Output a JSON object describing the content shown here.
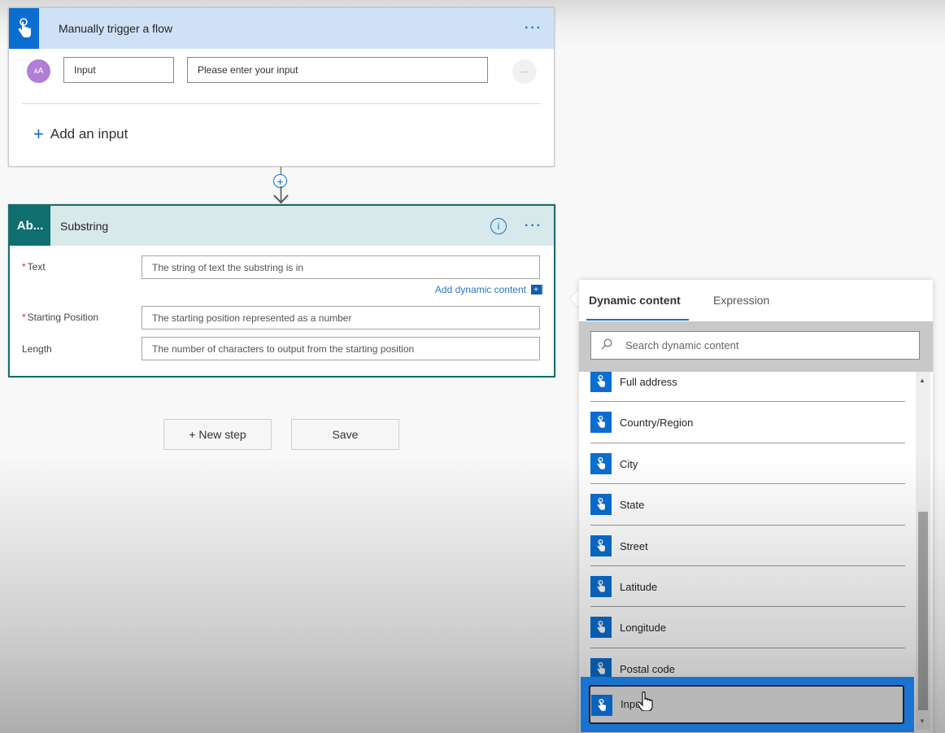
{
  "trigger": {
    "title": "Manually trigger a flow",
    "icon": "touch-hand-icon",
    "more_label": "···",
    "input_row": {
      "avatar_text": "ᴀA",
      "name_value": "Input",
      "prompt_value": "Please enter your input",
      "more_label": "···"
    },
    "add_input_label": "Add an input",
    "add_input_icon": "+"
  },
  "connector": {
    "plus": "+"
  },
  "action": {
    "icon_text": "Ab...",
    "title": "Substring",
    "info_label": "i",
    "more_label": "···",
    "fields": [
      {
        "label": "Text",
        "required": true,
        "placeholder": "The string of text the substring is in"
      },
      {
        "label": "Starting Position",
        "required": true,
        "placeholder": "The starting position represented as a number"
      },
      {
        "label": "Length",
        "required": false,
        "placeholder": "The number of characters to output from the starting position"
      }
    ],
    "required_mark": "*",
    "add_dynamic_label": "Add dynamic content",
    "add_dynamic_icon": "+"
  },
  "buttons": {
    "new_step": "+ New step",
    "save": "Save"
  },
  "dynamic_panel": {
    "tabs": [
      {
        "label": "Dynamic content",
        "active": true
      },
      {
        "label": "Expression",
        "active": false
      }
    ],
    "search_placeholder": "Search dynamic content",
    "items": [
      "Full address",
      "Country/Region",
      "City",
      "State",
      "Street",
      "Latitude",
      "Longitude",
      "Postal code"
    ],
    "selected_item": "Input",
    "colors": {
      "icon_bg": "#0a6ed1",
      "selection_outline": "#1a73d0"
    }
  },
  "colors": {
    "trigger_header": "#cfe1f7",
    "trigger_icon": "#0a6ed1",
    "action_header": "#d7e9ea",
    "action_icon": "#0f6e6e",
    "link": "#2b74c6"
  }
}
